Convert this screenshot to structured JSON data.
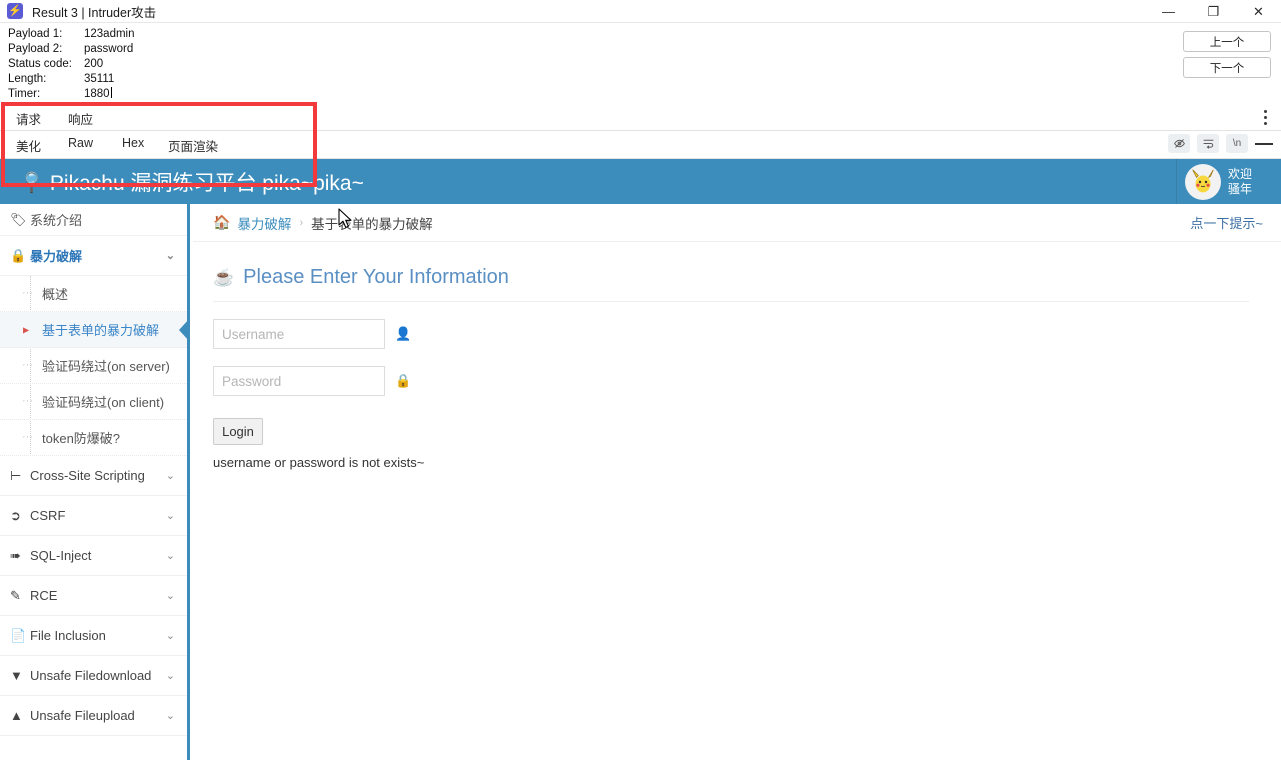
{
  "window": {
    "title": "Result 3 | Intruder攻击",
    "app_icon": "burp-lightning-icon",
    "minimize": "—",
    "maximize": "❐",
    "close": "✕"
  },
  "summary": {
    "rows": [
      {
        "label": "Payload 1:",
        "value": "123admin"
      },
      {
        "label": "Payload 2:",
        "value": "password"
      },
      {
        "label": "Status code:",
        "value": "200"
      },
      {
        "label": "Length:",
        "value": "35111"
      },
      {
        "label": "Timer:",
        "value": "1880"
      }
    ]
  },
  "nav": {
    "prev_label": "上一个",
    "next_label": "下一个"
  },
  "tabs_primary": [
    {
      "label": "请求",
      "active": false
    },
    {
      "label": "响应",
      "active": true
    }
  ],
  "tabs_secondary": [
    {
      "label": "美化",
      "active": false
    },
    {
      "label": "Raw",
      "active": false
    },
    {
      "label": "Hex",
      "active": false
    },
    {
      "label": "页面渲染",
      "active": true
    }
  ],
  "render_tools": [
    {
      "icon": "eye-off-icon",
      "glyph": "ø"
    },
    {
      "icon": "word-wrap-icon",
      "glyph": "↵"
    },
    {
      "icon": "newline-icon",
      "glyph": "\\n"
    },
    {
      "icon": "hamburger-menu-icon",
      "glyph": "☰"
    }
  ],
  "kebab_icon": "more-options-icon",
  "pikachu": {
    "brand": "Pikachu 漏洞练习平台 pika~pika~",
    "brand_icon": "magnifier-icon",
    "avatar_icon": "pikachu-avatar",
    "welcome_line1": "欢迎",
    "welcome_line2": "骚年",
    "header_color": "#3c8dbc"
  },
  "sidebar": {
    "intro": {
      "label": "系统介绍",
      "icon": "tag-icon"
    },
    "sections": [
      {
        "label": "暴力破解",
        "icon": "lock-icon",
        "expanded": true,
        "chevron": "⌄",
        "items": [
          {
            "label": "概述",
            "active": false
          },
          {
            "label": "基于表单的暴力破解",
            "active": true
          },
          {
            "label": "验证码绕过(on server)",
            "active": false
          },
          {
            "label": "验证码绕过(on client)",
            "active": false
          },
          {
            "label": "token防爆破?",
            "active": false
          }
        ]
      },
      {
        "label": "Cross-Site Scripting",
        "icon": "sitemap-icon",
        "expanded": false,
        "chevron": "⌄",
        "items": []
      },
      {
        "label": "CSRF",
        "icon": "share-icon",
        "expanded": false,
        "chevron": "⌄",
        "items": []
      },
      {
        "label": "SQL-Inject",
        "icon": "plane-icon",
        "expanded": false,
        "chevron": "⌄",
        "items": []
      },
      {
        "label": "RCE",
        "icon": "pencil-icon",
        "expanded": false,
        "chevron": "⌄",
        "items": []
      },
      {
        "label": "File Inclusion",
        "icon": "file-icon",
        "expanded": false,
        "chevron": "⌄",
        "items": []
      },
      {
        "label": "Unsafe Filedownload",
        "icon": "download-icon",
        "expanded": false,
        "chevron": "⌄",
        "items": []
      },
      {
        "label": "Unsafe Fileupload",
        "icon": "upload-icon",
        "expanded": false,
        "chevron": "⌄",
        "items": []
      }
    ]
  },
  "breadcrumb": {
    "home_icon": "home-icon",
    "parent": "暴力破解",
    "separator": "›",
    "current": "基于表单的暴力破解",
    "tip_link": "点一下提示~"
  },
  "form": {
    "title": "Please Enter Your Information",
    "title_icon": "coffee-cup-icon",
    "username": {
      "value": "",
      "placeholder": "Username",
      "icon": "user-icon"
    },
    "password": {
      "value": "",
      "placeholder": "Password",
      "icon": "lock-icon"
    },
    "login_label": "Login",
    "error_message": "username or password is not exists~"
  },
  "annotation": {
    "color": "#f4393c"
  }
}
